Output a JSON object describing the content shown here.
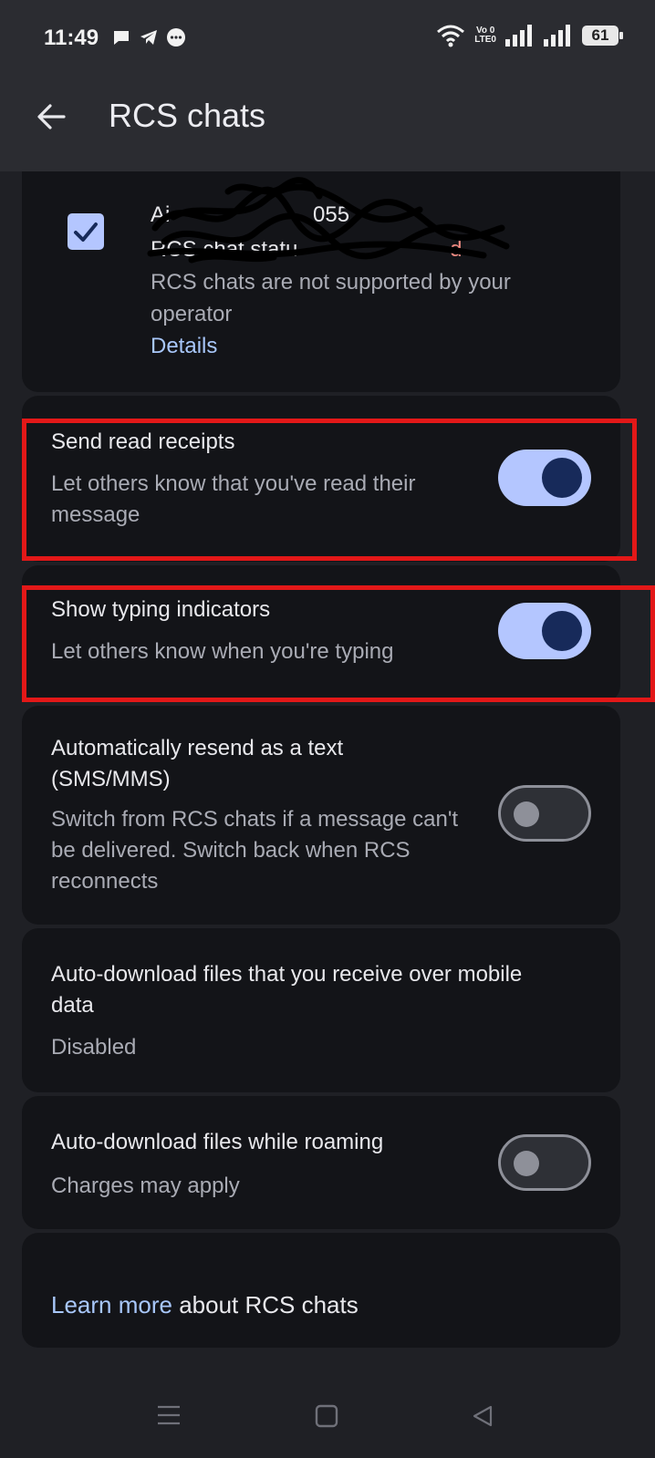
{
  "status_bar": {
    "time": "11:49",
    "lte_top": "Vo 0",
    "lte_bottom": "LTE0",
    "battery": "61"
  },
  "header": {
    "title": "RCS chats"
  },
  "sim": {
    "name_partial": "Ai",
    "number_partial": "055",
    "status_label_partial": "RCS chat statu",
    "status_error_partial": "d",
    "message": "RCS chats are not supported by your operator",
    "details_link": "Details",
    "checked": true
  },
  "settings": [
    {
      "title": "Send read receipts",
      "subtitle": "Let others know that you've read their message",
      "enabled": true
    },
    {
      "title": "Show typing indicators",
      "subtitle": "Let others know when you're typing",
      "enabled": true
    },
    {
      "title": "Automatically resend as a text (SMS/MMS)",
      "subtitle": "Switch from RCS chats if a message can't be delivered. Switch back when RCS reconnects",
      "enabled": false
    },
    {
      "title": "Auto-download files that you receive over mobile data",
      "subtitle": "Disabled"
    },
    {
      "title": "Auto-download files while roaming",
      "subtitle": "Charges may apply",
      "enabled": false
    }
  ],
  "footer": {
    "learn_more_link": "Learn more",
    "learn_more_rest": " about RCS chats"
  },
  "colors": {
    "accent": "#b4c6ff",
    "link": "#a8c7fa",
    "highlight": "#e31818",
    "error": "#f28b82"
  }
}
